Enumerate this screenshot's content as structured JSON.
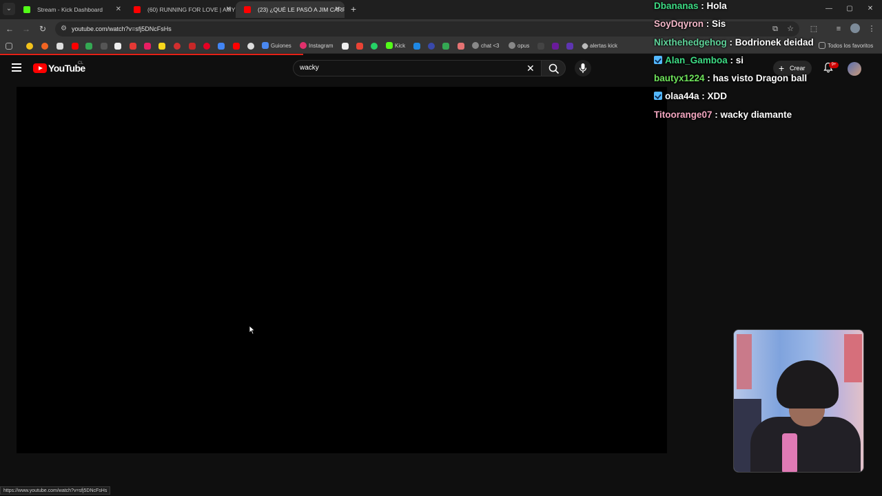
{
  "browser": {
    "tabs": [
      {
        "title": "Stream - Kick Dashboard",
        "favicon_color": "#53fc18",
        "active": false
      },
      {
        "title": "(60) RUNNING FOR LOVE | AMY",
        "favicon_color": "#ff0000",
        "active": false
      },
      {
        "title": "(23) ¿QUÉ LE PASÓ A JIM CARR",
        "favicon_color": "#ff0000",
        "active": true
      }
    ],
    "new_tab_label": "+",
    "url": "youtube.com/watch?v=sfj5DNcFsHs",
    "bookmarks": [
      {
        "label": "Guiones",
        "color": "#4a88f0"
      },
      {
        "label": "Instagram",
        "color": "#e1306c"
      },
      {
        "label": "Kick",
        "color": "#53fc18"
      },
      {
        "label": "chat <3",
        "color": "#888888"
      },
      {
        "label": "opus",
        "color": "#888888"
      },
      {
        "label": "alertas kick",
        "color": "#bbbbbb"
      }
    ],
    "all_bookmarks_label": "Todos los favoritos",
    "status_url": "https://www.youtube.com/watch?v=sfj5DNcFsHs"
  },
  "youtube": {
    "wordmark": "YouTube",
    "country": "CL",
    "search_value": "wacky",
    "create_label": "Crear",
    "notifications_badge": "9+"
  },
  "chat": [
    {
      "user": "Dbananas",
      "message": "Hola",
      "color": "#3ddc84",
      "verified": false
    },
    {
      "user": "SoyDqyron",
      "message": "Sis",
      "color": "#f3b7c8",
      "verified": false
    },
    {
      "user": "Nixthehedgehog",
      "message": "Bodrionek deidad",
      "color": "#5fd39a",
      "verified": false
    },
    {
      "user": "Alan_Gamboa",
      "message": "si",
      "color": "#3ddc84",
      "verified": true
    },
    {
      "user": "bautyx1224",
      "message": "has visto Dragon ball",
      "color": "#6ee35a",
      "verified": false
    },
    {
      "user": "olaa44a",
      "message": "XDD",
      "color": "#ffffff",
      "verified": true
    },
    {
      "user": "Titoorange07",
      "message": "wacky diamante",
      "color": "#f3a6c0",
      "verified": false
    }
  ]
}
